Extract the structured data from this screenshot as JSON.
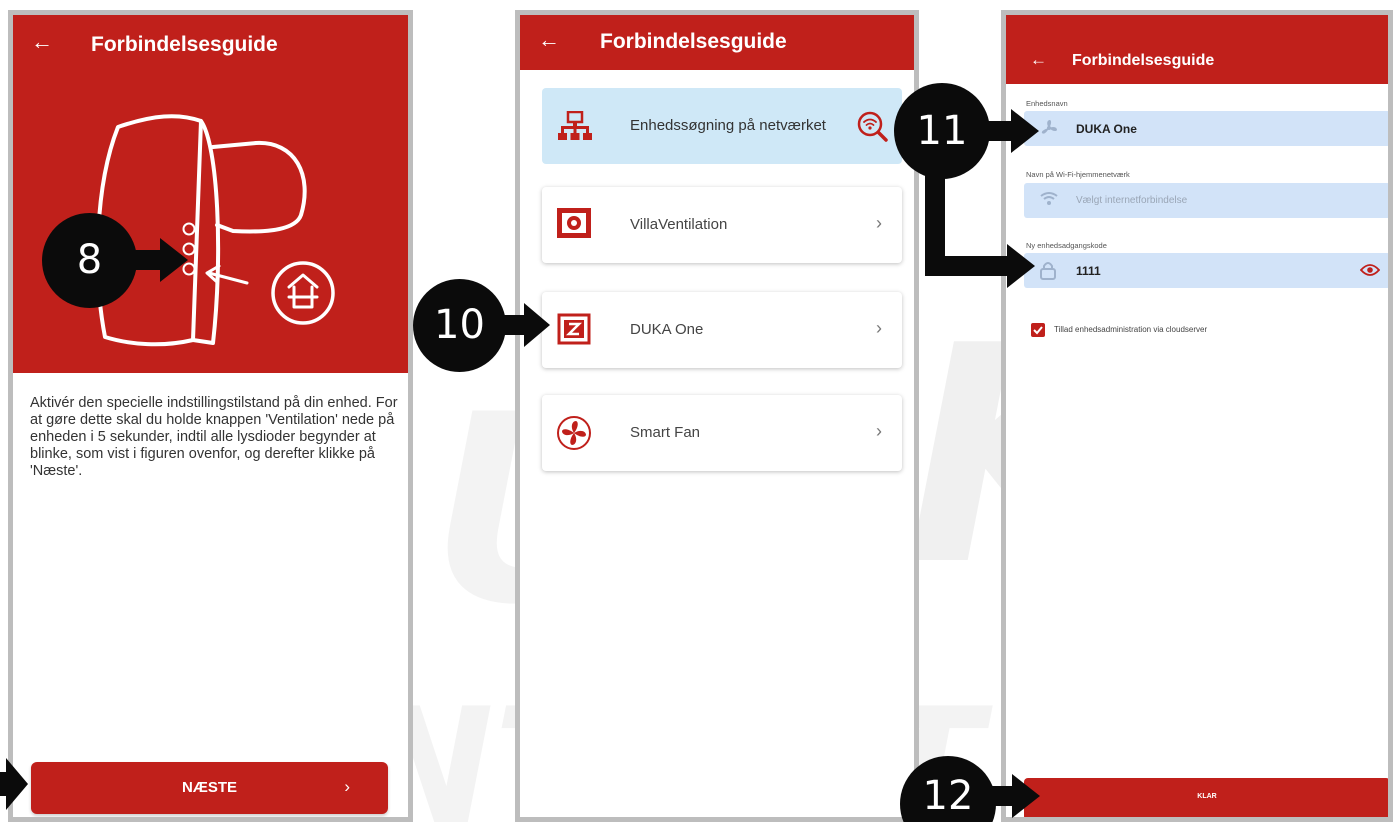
{
  "app": {
    "back_glyph": "←",
    "title": "Forbindelsesguide"
  },
  "screen1": {
    "instructions": "Aktivér den specielle indstillingstilstand på din enhed. For at gøre dette skal du holde knappen 'Ventilation' nede på enheden i 5 sekunder, indtil alle lysdioder begynder at blinke, som vist i figuren ovenfor, og derefter klikke på 'Næste'.",
    "next_button": "NÆSTE",
    "next_chevron": "›",
    "illustration_icon": "device-with-mode-button-icon"
  },
  "screen2": {
    "search_label": "Enhedssøgning på netværket",
    "devices": [
      {
        "label": "VillaVentilation",
        "icon": "villaventilation-icon"
      },
      {
        "label": "DUKA One",
        "icon": "duka-one-icon"
      },
      {
        "label": "Smart Fan",
        "icon": "smart-fan-icon"
      }
    ],
    "chevron": "›"
  },
  "screen3": {
    "name_label": "Enhedsnavn",
    "name_value": "DUKA One",
    "wifi_label": "Navn på Wi-Fi-hjemmenetværk",
    "wifi_placeholder": "Vælgt internetforbindelse",
    "password_label": "Ny enhedsadgangskode",
    "password_value": "1111",
    "cloud_checkbox_label": "Tillad enhedsadministration via cloudserver",
    "cloud_checkbox_checked": true,
    "ready_button": "KLAR"
  },
  "callouts": {
    "step8": "8",
    "step10": "10",
    "step11": "11",
    "step12": "12"
  },
  "colors": {
    "brand_red": "#c0201b",
    "search_bg": "#cfe8f7",
    "field_bg": "#d2e3f8",
    "badge": "#0b0b0b"
  }
}
